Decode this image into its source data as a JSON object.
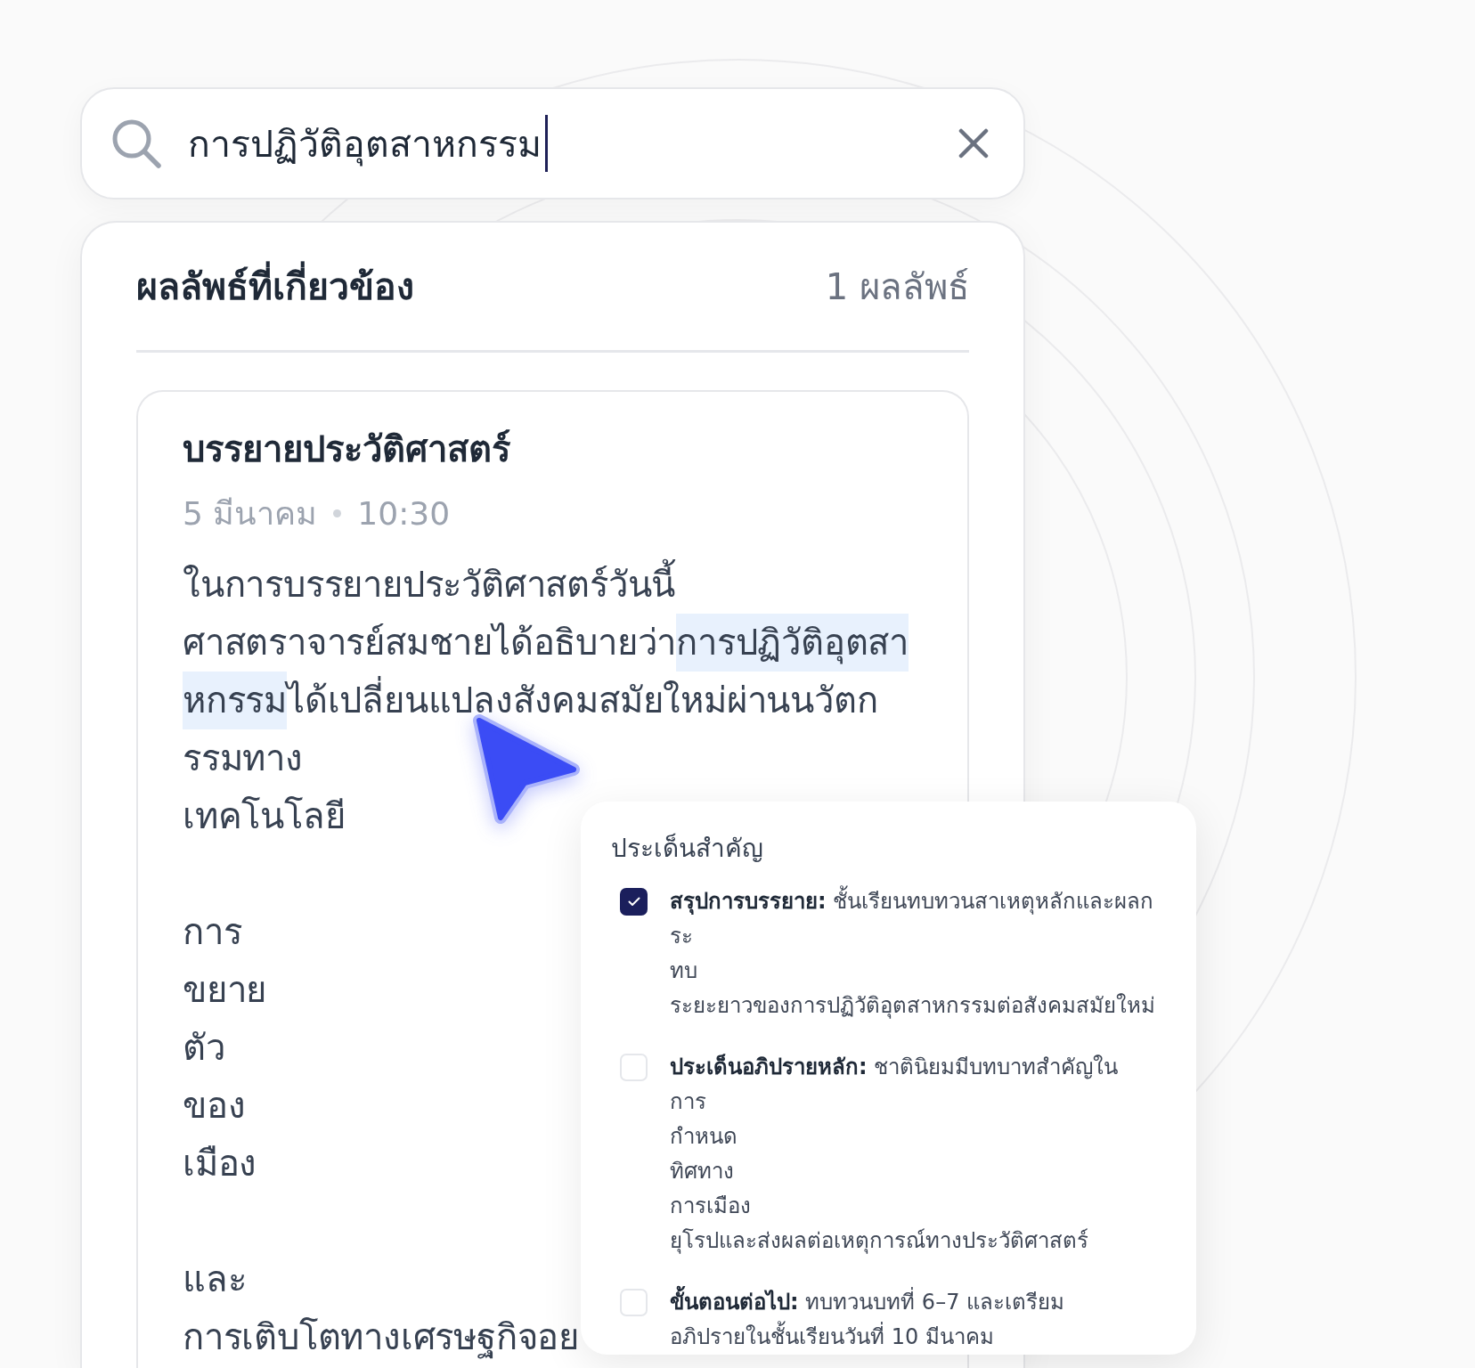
{
  "search": {
    "value": "การปฏิวัติอุตสาหกรรม",
    "focused": true
  },
  "results": {
    "title": "ผลลัพธ์ที่เกี่ยวข้อง",
    "count": "1 ผลลัพธ์",
    "items": [
      {
        "title": "บรรยายประวัติศาสตร์",
        "date": "5 มีนาคม",
        "time": "10:30",
        "paragraphs": [
          {
            "lines": [
              [
                {
                  "text": "ในการบรรยายประวัติศาสตร์วันนี้",
                  "highlighted": false
                }
              ],
              [
                {
                  "text": "ศาสตราจารย์สมชายได้อธิบายว่า",
                  "highlighted": false
                },
                {
                  "text": "การปฏิวัติอุตสา",
                  "highlighted": true
                }
              ],
              [
                {
                  "text": "หกรรม",
                  "highlighted": true
                },
                {
                  "text": "ได้เปลี่ยนแปลงสังคมสมัยใหม่ผ่านนวัตก",
                  "highlighted": false
                }
              ],
              [
                {
                  "text": "รรมทาง",
                  "highlighted": false
                }
              ],
              [
                {
                  "text": "เทคโนโลยี",
                  "highlighted": false
                }
              ]
            ]
          },
          {
            "lines": [
              [
                {
                  "text": "การ",
                  "highlighted": false
                }
              ],
              [
                {
                  "text": "ขยาย",
                  "highlighted": false
                }
              ],
              [
                {
                  "text": "ตัว",
                  "highlighted": false
                }
              ],
              [
                {
                  "text": "ของ",
                  "highlighted": false
                }
              ],
              [
                {
                  "text": "เมือง",
                  "highlighted": false
                }
              ]
            ]
          },
          {
            "lines": [
              [
                {
                  "text": "และ",
                  "highlighted": false
                }
              ],
              [
                {
                  "text": "การเติบโตทางเศรษฐกิจอย",
                  "highlighted": false
                }
              ]
            ]
          }
        ]
      }
    ]
  },
  "key_points": {
    "title": "ประเด็นสำคัญ",
    "items": [
      {
        "lines": [
          "**สรุปการบรรยาย:** ชั้นเรียนทบทวนสาเหตุหลักและผลก",
          "ระ",
          "ทบ",
          "ระยะยาวของการปฏิวัติอุตสาหกรรมต่อสังคมสมัยใหม่"
        ],
        "checked": true
      },
      {
        "lines": [
          "**ประเด็นอภิปรายหลัก:** ชาตินิยมมีบทบาทสำคัญใน",
          "การ",
          "กำหนด",
          "ทิศทาง",
          "การเมือง",
          "ยุโรปและส่งผลต่อเหตุการณ์ทางประวัติศาสตร์"
        ],
        "checked": false
      },
      {
        "lines": [
          "**ขั้นตอนต่อไป:** ทบทวนบทที่ 6–7 และเตรียม",
          "อภิปรายในชั้นเรียนวันที่ 10 มีนาคม"
        ],
        "checked": false
      }
    ]
  }
}
